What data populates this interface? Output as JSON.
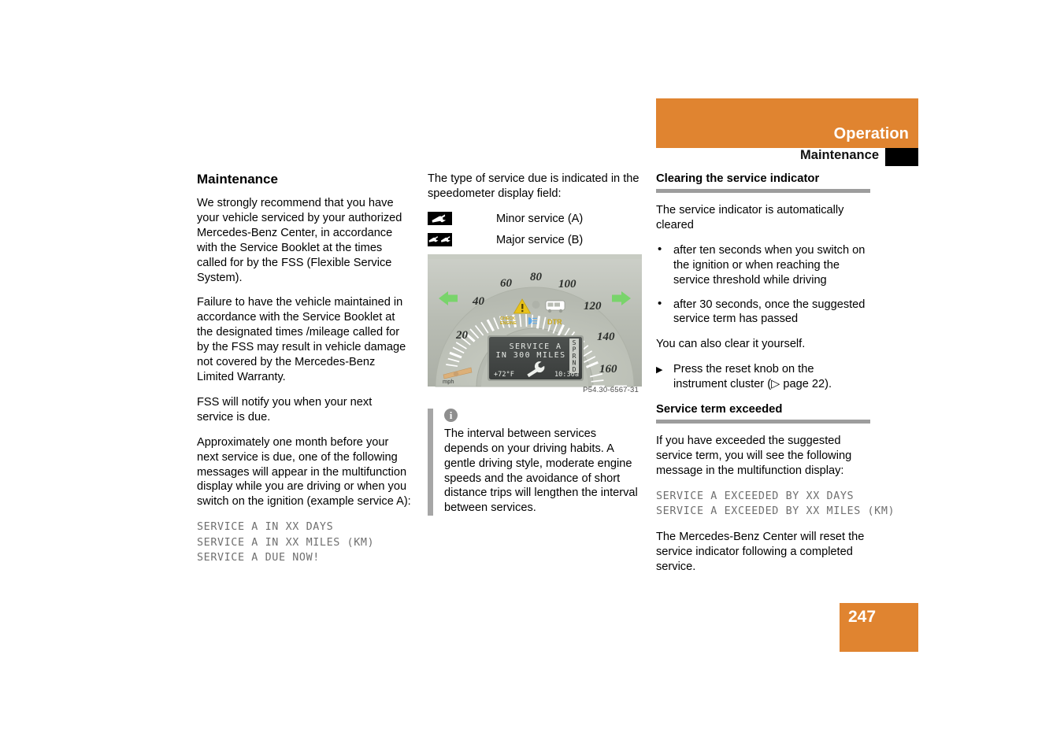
{
  "header": {
    "chapter": "Operation",
    "section": "Maintenance",
    "orange": "#e08430"
  },
  "page_number": "247",
  "col1": {
    "title": "Maintenance",
    "p1": "We strongly recommend that you have your vehicle serviced by your authorized Mercedes-Benz Center, in accordance with the Service Booklet at the times called for by the FSS (Flexible Service System).",
    "p2": "Failure to have the vehicle maintained in accordance with the Service Booklet at the designated times /mileage called for by the FSS may result in vehicle damage not covered by the Mercedes-Benz Limited Warranty.",
    "p3": "FSS will notify you when your next service is due.",
    "p4": "Approximately one month before your next service is due, one of the following messages will appear in the multifunction display while you are driving or when you switch on the ignition (example service A):",
    "display_messages": "SERVICE A IN XX DAYS\nSERVICE A IN XX MILES (KM)\nSERVICE A DUE NOW!"
  },
  "col2": {
    "p1": "The type of service due is indicated in the speedometer display field:",
    "legend": [
      {
        "icon": "single-wrench-icon",
        "label": "Minor service (A)"
      },
      {
        "icon": "double-wrench-icon",
        "label": "Major service (B)"
      }
    ],
    "figure": {
      "caption": "P54.30-6567-31",
      "speed_ticks": [
        "20",
        "40",
        "60",
        "80",
        "100",
        "120",
        "140",
        "160"
      ],
      "unit_label": "mph",
      "lcd_line1": "SERVICE A",
      "lcd_line2": "IN 300 MILES",
      "lcd_temp": "+72°F",
      "lcd_time": "10:30a",
      "gear_selector": "SPRND",
      "telltales": [
        "CHECK ENGINE",
        "DTR"
      ],
      "colors": {
        "cluster_bg": "#b9bdb4",
        "dial_face": "#c3c7bd",
        "lcd_bg": "#434645",
        "turn_signal_green": "#78d36a",
        "warning_amber": "#e8c21c",
        "needle": "#d9a96c"
      }
    },
    "note": {
      "icon": "info-icon",
      "text": "The interval between services depends on your driving habits. A gentle driving style, moderate engine speeds and the avoidance of short distance trips will lengthen the interval between services."
    }
  },
  "col3": {
    "heading1": "Clearing the service indicator",
    "p1": "The service indicator is automatically cleared",
    "bullets": [
      "after ten seconds when you switch on the ignition or when reaching the service threshold while driving",
      "after 30 seconds, once the suggested service term has passed"
    ],
    "p2": "You can also clear it yourself.",
    "step1": "Press the reset knob on the instrument cluster (▷ page 22).",
    "heading2": "Service term exceeded",
    "p3": "If you have exceeded the suggested service term, you will see the following message in the multifunction display:",
    "display_messages": "SERVICE A EXCEEDED BY XX DAYS\nSERVICE A EXCEEDED BY XX MILES (KM)",
    "p4": "The Mercedes-Benz Center will reset the service indicator following a completed service."
  }
}
